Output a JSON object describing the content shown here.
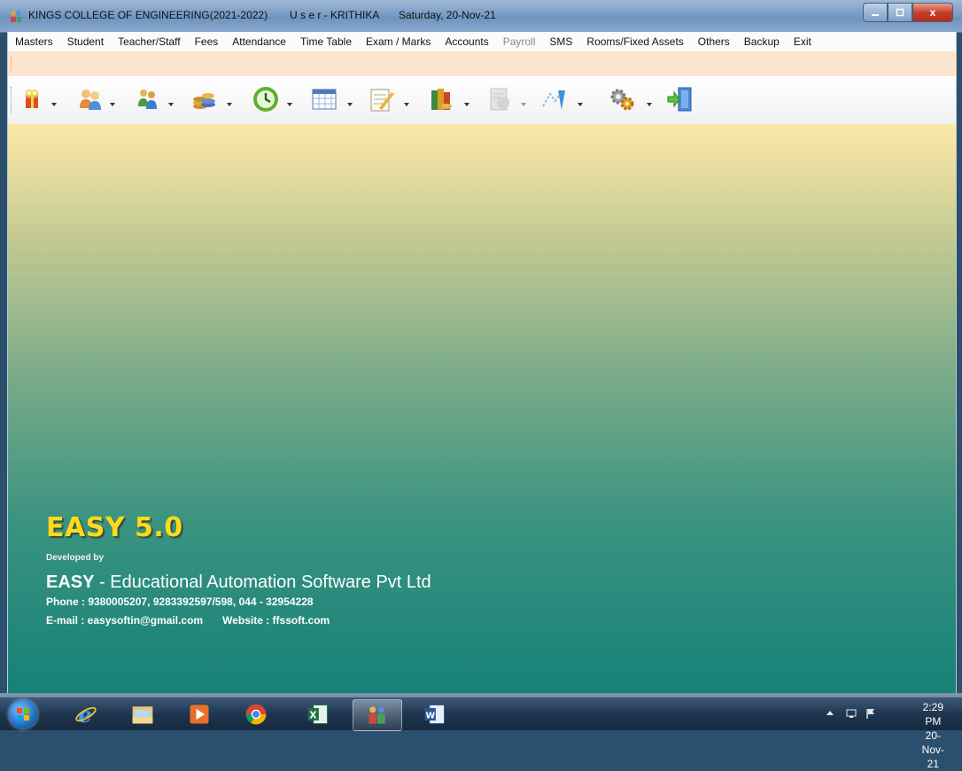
{
  "window": {
    "title_college": "KINGS COLLEGE OF ENGINEERING(2021-2022)",
    "title_user": "U s e r - KRITHIKA",
    "title_date": "Saturday, 20-Nov-21",
    "controls": {
      "minimize": "minimize-icon",
      "maximize": "maximize-icon",
      "close": "x"
    }
  },
  "menu": {
    "items": [
      {
        "label": "Masters"
      },
      {
        "label": "Student"
      },
      {
        "label": "Teacher/Staff"
      },
      {
        "label": "Fees"
      },
      {
        "label": "Attendance"
      },
      {
        "label": "Time Table"
      },
      {
        "label": "Exam / Marks"
      },
      {
        "label": "Accounts"
      },
      {
        "label": "Payroll",
        "disabled": true
      },
      {
        "label": "SMS"
      },
      {
        "label": "Rooms/Fixed Assets"
      },
      {
        "label": "Others"
      },
      {
        "label": "Backup"
      },
      {
        "label": "Exit"
      }
    ]
  },
  "toolbar": {
    "buttons": [
      {
        "icon": "gift-icon"
      },
      {
        "icon": "people-icon"
      },
      {
        "icon": "teacher-icon"
      },
      {
        "icon": "coins-icon"
      },
      {
        "icon": "clock-icon"
      },
      {
        "icon": "calendar-icon"
      },
      {
        "icon": "notepad-icon"
      },
      {
        "icon": "books-icon"
      },
      {
        "icon": "payroll-icon"
      },
      {
        "icon": "sms-icon"
      },
      {
        "icon": "settings-gears-icon"
      },
      {
        "icon": "exit-door-icon"
      }
    ]
  },
  "branding": {
    "product": "EASY 5.0",
    "developed_by": "Developed by",
    "company_bold": "EASY",
    "company_rest": " - Educational Automation Software Pvt Ltd",
    "phone": "Phone : 9380005207, 9283392597/598,  044 - 32954228",
    "email": "E-mail : easysoftin@gmail.com",
    "website": "Website : ffssoft.com"
  },
  "taskbar": {
    "apps": [
      {
        "icon": "internet-explorer-icon"
      },
      {
        "icon": "file-explorer-icon"
      },
      {
        "icon": "media-player-icon"
      },
      {
        "icon": "chrome-icon"
      },
      {
        "icon": "excel-icon"
      },
      {
        "icon": "easy-app-icon",
        "active": true
      },
      {
        "icon": "word-icon"
      }
    ],
    "clock_time": "2:29 PM",
    "clock_date": "20-Nov-21"
  },
  "colors": {
    "brand_yellow": "#ffd91a",
    "bg_top": "#fde9a8",
    "bg_bottom": "#168178"
  }
}
